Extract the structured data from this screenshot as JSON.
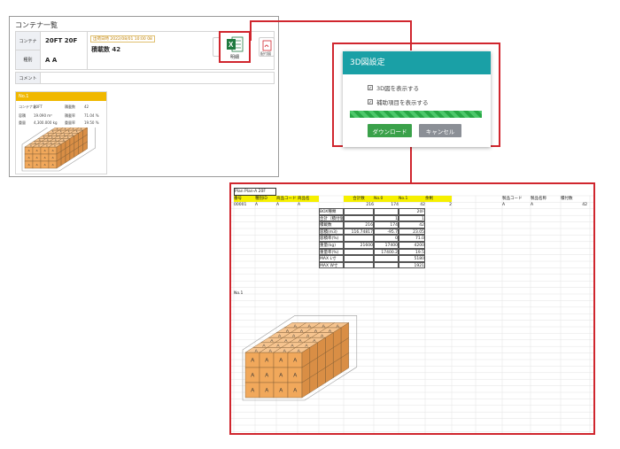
{
  "panel": {
    "title": "コンテナ一覧",
    "container_label": "コンテナ",
    "container_value": "20FT 20F",
    "type_label": "種別",
    "type_value": "A A",
    "date_text": "出荷日時 2022/08/01 10:00 08",
    "load_count": "積載数 42",
    "comment_label": "コメント",
    "toolbar": {
      "output_label": "出荷",
      "detail_label": "明細",
      "drawing_label": "配付図"
    },
    "card": {
      "header": "No.1",
      "container_label": "コンテナ名",
      "container_value": "20FT",
      "load_label": "積載数",
      "load_value": "42",
      "volume_label": "容積",
      "volume_value": "19.090 m³",
      "volume_rate_label": "積載率",
      "volume_rate": "71.04 %",
      "weight_label": "重量",
      "weight_value": "4,300.000 kg",
      "weight_rate_label": "重量率",
      "weight_rate": "19.50 %",
      "box_letter": "A"
    }
  },
  "dialog": {
    "title": "3D図設定",
    "option1": "3D図を表示する",
    "option2": "補助項目を表示する",
    "download": "ダウンロード",
    "cancel": "キャンセル",
    "progress": 1.0
  },
  "sheet": {
    "plan_label": "Plan Plan-A 20F",
    "headers": [
      "番号",
      "種別ID",
      "商品コード",
      "商品名",
      "",
      "合計数",
      "No.0",
      "No.1",
      "余剰"
    ],
    "row1": [
      "00001",
      "A",
      "A",
      "A",
      "",
      "216",
      "174",
      "42",
      "2"
    ],
    "right_headers": [
      "製品コード",
      "製品名称",
      "積付数"
    ],
    "right_row": [
      "A",
      "A",
      "42"
    ],
    "summary_headers": [
      "",
      "",
      "20F"
    ],
    "summary": [
      [
        "BOX種類",
        "",
        "",
        "20F"
      ],
      [
        "合計（積付個数）",
        "",
        "1",
        "1"
      ],
      [
        "積載数",
        "216",
        "174",
        "42"
      ],
      [
        "容積(m3)",
        "116.74817",
        "-95.7",
        "23.05"
      ],
      [
        "容積率(%)",
        "",
        "0",
        "71.0"
      ],
      [
        "重量(kg)",
        "21600",
        "17400",
        "4200"
      ],
      [
        "重量率(%)",
        "",
        "17400.2",
        "19.5"
      ],
      [
        "MAX L寸",
        "",
        "",
        "5180"
      ],
      [
        "MAX W寸",
        "",
        "",
        "1921"
      ]
    ],
    "no_label": "No.1",
    "box_letter": "A"
  }
}
